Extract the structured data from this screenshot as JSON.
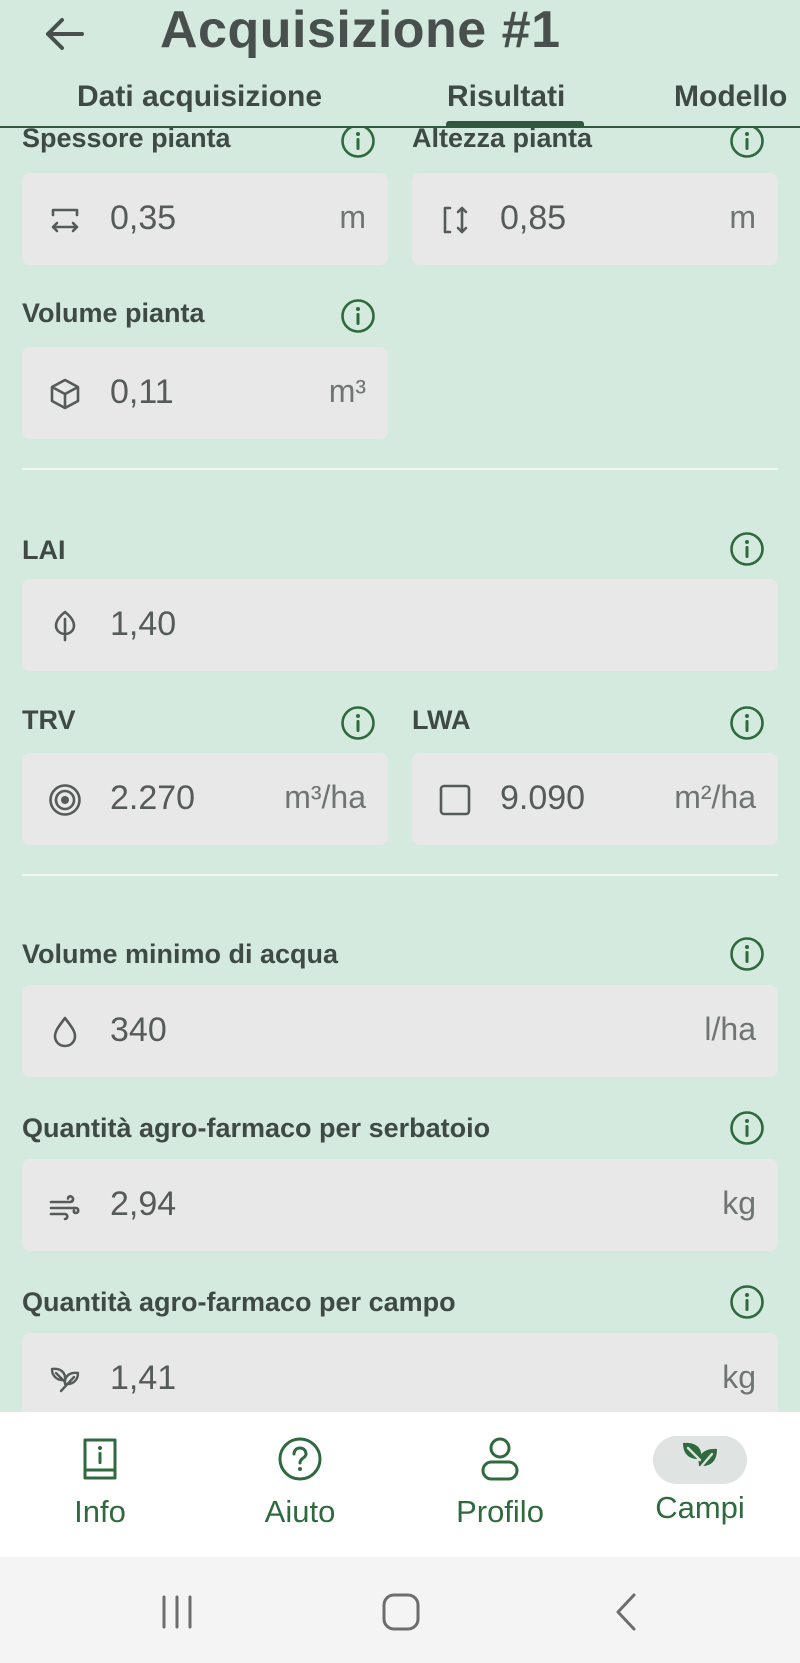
{
  "header": {
    "title": "Acquisizione #1",
    "tabs": [
      "Dati acquisizione",
      "Risultati",
      "Modello"
    ],
    "active_tab": "Risultati"
  },
  "fields": {
    "spessore": {
      "label": "Spessore pianta",
      "value": "0,35",
      "unit": "m",
      "icon": "horizontal-expand-icon"
    },
    "altezza": {
      "label": "Altezza pianta",
      "value": "0,85",
      "unit": "m",
      "icon": "vertical-expand-icon"
    },
    "volume": {
      "label": "Volume pianta",
      "value": "0,11",
      "unit": "m³",
      "icon": "cube-icon"
    },
    "lai": {
      "label": "LAI",
      "value": "1,40",
      "unit": "",
      "icon": "leaf-icon"
    },
    "trv": {
      "label": "TRV",
      "value": "2.270",
      "unit": "m³/ha",
      "icon": "target-icon"
    },
    "lwa": {
      "label": "LWA",
      "value": "9.090",
      "unit": "m²/ha",
      "icon": "square-icon"
    },
    "volume_acqua": {
      "label": "Volume minimo di acqua",
      "value": "340",
      "unit": "l/ha",
      "icon": "water-drop-icon"
    },
    "qta_serbatoio": {
      "label": "Quantità agro-farmaco per serbatoio",
      "value": "2,94",
      "unit": "kg",
      "icon": "wind-icon"
    },
    "qta_campo": {
      "label": "Quantità agro-farmaco per campo",
      "value": "1,41",
      "unit": "kg",
      "icon": "leaves-icon"
    }
  },
  "bottom_nav": {
    "items": [
      {
        "label": "Info",
        "icon": "book-info-icon"
      },
      {
        "label": "Aiuto",
        "icon": "help-circle-icon"
      },
      {
        "label": "Profilo",
        "icon": "user-icon"
      },
      {
        "label": "Campi",
        "icon": "leaf-badge-icon"
      }
    ],
    "active": "Campi"
  },
  "colors": {
    "background": "#d5eadf",
    "accent": "#2f6a3e",
    "field_bg": "#e8e8e8"
  }
}
